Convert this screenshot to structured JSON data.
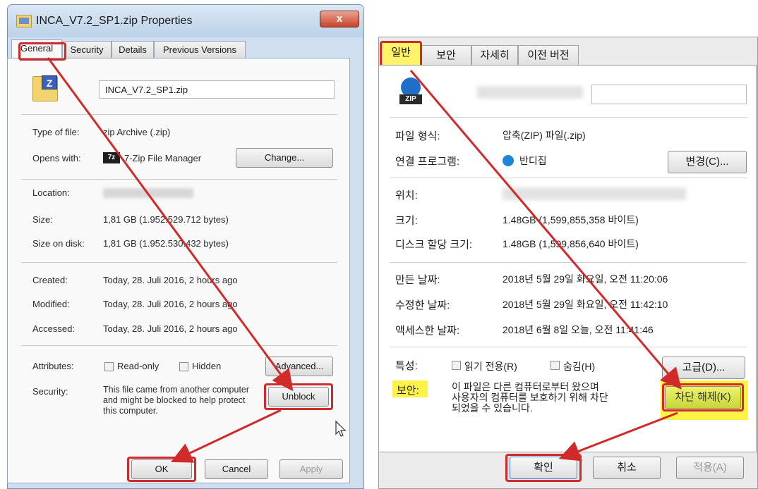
{
  "left": {
    "title": "INCA_V7.2_SP1.zip Properties",
    "close_label": "x",
    "tabs": [
      "General",
      "Security",
      "Details",
      "Previous Versions"
    ],
    "file_icon_letter": "Z",
    "filename": "INCA_V7.2_SP1.zip",
    "type_label": "Type of file:",
    "type_value": "zip Archive (.zip)",
    "opens_label": "Opens with:",
    "opens_icon_text": "7z",
    "opens_value": "7-Zip File Manager",
    "change_button": "Change...",
    "location_label": "Location:",
    "size_label": "Size:",
    "size_value": "1,81 GB (1.952.529.712 bytes)",
    "size_on_disk_label": "Size on disk:",
    "size_on_disk_value": "1,81 GB (1.952.530.432 bytes)",
    "created_label": "Created:",
    "created_value": "Today, 28. Juli 2016, 2 hours ago",
    "modified_label": "Modified:",
    "modified_value": "Today, 28. Juli 2016, 2 hours ago",
    "accessed_label": "Accessed:",
    "accessed_value": "Today, 28. Juli 2016, 2 hours ago",
    "attributes_label": "Attributes:",
    "readonly_label": "Read-only",
    "hidden_label": "Hidden",
    "advanced_button": "Advanced...",
    "security_label": "Security:",
    "security_text": "This file came from another computer and might be blocked to help protect this computer.",
    "unblock_button": "Unblock",
    "ok_button": "OK",
    "cancel_button": "Cancel",
    "apply_button": "Apply"
  },
  "right": {
    "tabs": [
      "일반",
      "보안",
      "자세히",
      "이전 버전"
    ],
    "file_icon_text": "ZIP",
    "type_label": "파일 형식:",
    "type_value": "압축(ZIP) 파일(.zip)",
    "opens_label": "연결 프로그램:",
    "opens_value": "반디집",
    "change_button": "변경(C)...",
    "location_label": "위치:",
    "size_label": "크기:",
    "size_value": "1.48GB (1,599,855,358 바이트)",
    "size_on_disk_label": "디스크 할당 크기:",
    "size_on_disk_value": "1.48GB (1,599,856,640 바이트)",
    "created_label": "만든 날짜:",
    "created_value": "2018년 5월 29일 화요일, 오전 11:20:06",
    "modified_label": "수정한 날짜:",
    "modified_value": "2018년 5월 29일 화요일, 오전 11:42:10",
    "accessed_label": "액세스한 날짜:",
    "accessed_value": "2018년 6월 8일 오늘, 오전 11:41:46",
    "attributes_label": "특성:",
    "readonly_label": "읽기 전용(R)",
    "hidden_label": "숨김(H)",
    "advanced_button": "고급(D)...",
    "security_label": "보안:",
    "security_text_1": "이 파일은 다른 컴퓨터로부터 왔으며",
    "security_text_2": "사용자의 컴퓨터를 보호하기 위해 차단",
    "security_text_3": "되었을 수 있습니다.",
    "unblock_button": "차단 해제(K)",
    "ok_button": "확인",
    "cancel_button": "취소",
    "apply_button": "적용(A)"
  },
  "colors": {
    "highlight_red": "#d12a2a",
    "highlight_yellow": "#fff34a"
  }
}
